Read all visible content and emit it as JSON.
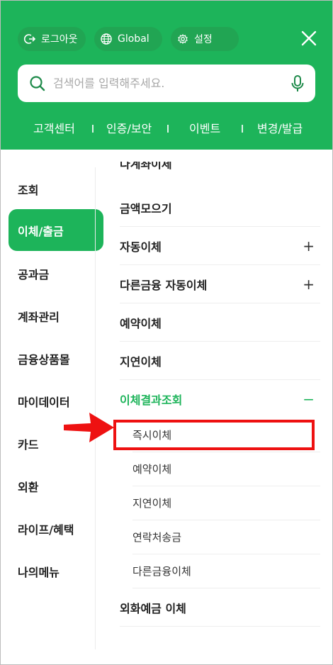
{
  "header": {
    "logout_label": "로그아웃",
    "global_label": "Global",
    "settings_label": "설정",
    "search_placeholder": "검색어를 입력해주세요.",
    "quick_links": [
      "고객센터",
      "인증/보안",
      "이벤트",
      "변경/발급"
    ]
  },
  "left_nav": {
    "items": [
      "조회",
      "이체/출금",
      "공과금",
      "계좌관리",
      "금융상품몰",
      "마이데이터",
      "카드",
      "외환",
      "라이프/혜택",
      "나의메뉴"
    ],
    "active_index": 1
  },
  "right_menu": {
    "clipped_item": "다계좌이체",
    "items": [
      "금액모으기",
      "자동이체",
      "다른금융 자동이체",
      "예약이체",
      "지연이체",
      "이체결과조회",
      "외화예금 이체"
    ],
    "expand_plus": "+",
    "collapse_minus": "−",
    "sub_items": [
      "즉시이체",
      "예약이체",
      "지연이체",
      "연락처송금",
      "다른금융이체"
    ]
  },
  "colors": {
    "brand_green": "#1db45a",
    "highlight_red": "#ee1111"
  },
  "icons": [
    "logout-icon",
    "globe-icon",
    "gear-icon",
    "close-icon",
    "search-icon",
    "microphone-icon",
    "arrow-annotation-icon"
  ]
}
